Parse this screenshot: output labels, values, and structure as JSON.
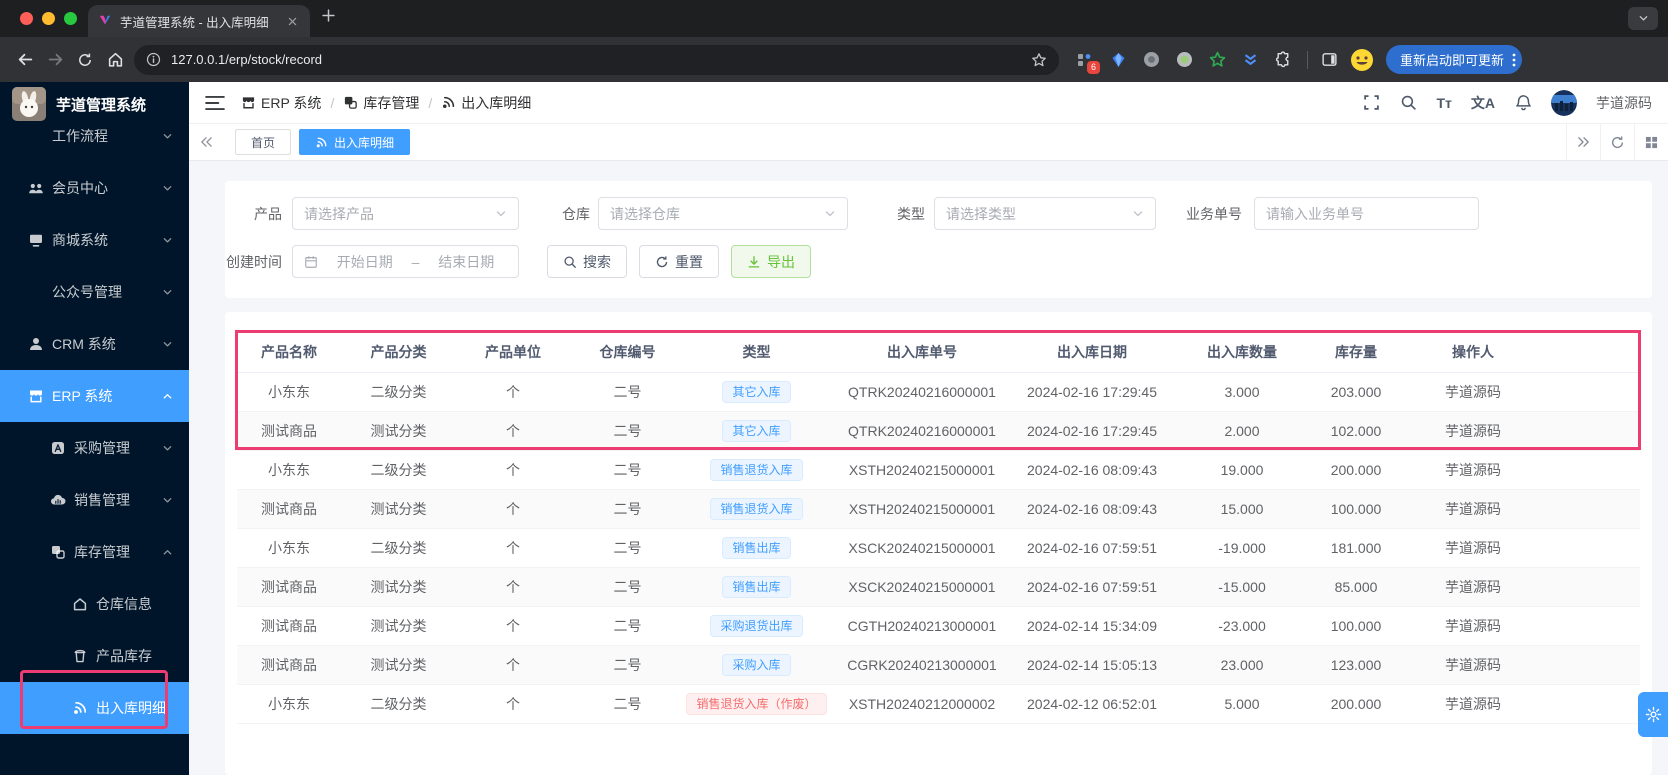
{
  "browser": {
    "tab_title": "芋道管理系统 - 出入库明细",
    "url": "127.0.0.1/erp/stock/record",
    "update_button_label": "重新启动即可更新",
    "extension_badge": "6"
  },
  "sidebar": {
    "logo_title": "芋道管理系统",
    "items": [
      {
        "label": "工作流程"
      },
      {
        "label": "会员中心"
      },
      {
        "label": "商城系统"
      },
      {
        "label": "公众号管理"
      },
      {
        "label": "CRM 系统"
      },
      {
        "label": "ERP 系统",
        "active": true
      },
      {
        "label": "采购管理"
      },
      {
        "label": "销售管理"
      },
      {
        "label": "库存管理"
      },
      {
        "label": "仓库信息"
      },
      {
        "label": "产品库存"
      },
      {
        "label": "出入库明细",
        "active": true
      }
    ]
  },
  "header": {
    "breadcrumb": [
      {
        "label": "ERP 系统"
      },
      {
        "label": "库存管理"
      },
      {
        "label": "出入库明细"
      }
    ],
    "icon_texts": {
      "font_size": "Tт",
      "translate": "文A"
    },
    "username": "芋道源码"
  },
  "tabbar": {
    "tabs": [
      {
        "label": "首页"
      },
      {
        "label": "出入库明细",
        "active": true
      }
    ]
  },
  "filters": {
    "product_label": "产品",
    "product_placeholder": "请选择产品",
    "warehouse_label": "仓库",
    "warehouse_placeholder": "请选择仓库",
    "type_label": "类型",
    "type_placeholder": "请选择类型",
    "bizno_label": "业务单号",
    "bizno_placeholder": "请输入业务单号",
    "created_label": "创建时间",
    "start_placeholder": "开始日期",
    "range_separator": "–",
    "end_placeholder": "结束日期",
    "search_label": "搜索",
    "reset_label": "重置",
    "export_label": "导出"
  },
  "table": {
    "columns": [
      "产品名称",
      "产品分类",
      "产品单位",
      "仓库编号",
      "类型",
      "出入库单号",
      "出入库日期",
      "出入库数量",
      "库存量",
      "操作人"
    ],
    "rows": [
      {
        "product": "小东东",
        "category": "二级分类",
        "unit": "个",
        "warehouse": "二号",
        "type": "其它入库",
        "type_color": "blue",
        "order_no": "QTRK20240216000001",
        "date": "2024-02-16 17:29:45",
        "quantity": "3.000",
        "stock": "203.000",
        "operator": "芋道源码"
      },
      {
        "product": "测试商品",
        "category": "测试分类",
        "unit": "个",
        "warehouse": "二号",
        "type": "其它入库",
        "type_color": "blue",
        "order_no": "QTRK20240216000001",
        "date": "2024-02-16 17:29:45",
        "quantity": "2.000",
        "stock": "102.000",
        "operator": "芋道源码"
      },
      {
        "product": "小东东",
        "category": "二级分类",
        "unit": "个",
        "warehouse": "二号",
        "type": "销售退货入库",
        "type_color": "blue",
        "order_no": "XSTH20240215000001",
        "date": "2024-02-16 08:09:43",
        "quantity": "19.000",
        "stock": "200.000",
        "operator": "芋道源码"
      },
      {
        "product": "测试商品",
        "category": "测试分类",
        "unit": "个",
        "warehouse": "二号",
        "type": "销售退货入库",
        "type_color": "blue",
        "order_no": "XSTH20240215000001",
        "date": "2024-02-16 08:09:43",
        "quantity": "15.000",
        "stock": "100.000",
        "operator": "芋道源码"
      },
      {
        "product": "小东东",
        "category": "二级分类",
        "unit": "个",
        "warehouse": "二号",
        "type": "销售出库",
        "type_color": "blue",
        "order_no": "XSCK20240215000001",
        "date": "2024-02-16 07:59:51",
        "quantity": "-19.000",
        "stock": "181.000",
        "operator": "芋道源码"
      },
      {
        "product": "测试商品",
        "category": "测试分类",
        "unit": "个",
        "warehouse": "二号",
        "type": "销售出库",
        "type_color": "blue",
        "order_no": "XSCK20240215000001",
        "date": "2024-02-16 07:59:51",
        "quantity": "-15.000",
        "stock": "85.000",
        "operator": "芋道源码"
      },
      {
        "product": "测试商品",
        "category": "测试分类",
        "unit": "个",
        "warehouse": "二号",
        "type": "采购退货出库",
        "type_color": "blue",
        "order_no": "CGTH20240213000001",
        "date": "2024-02-14 15:34:09",
        "quantity": "-23.000",
        "stock": "100.000",
        "operator": "芋道源码"
      },
      {
        "product": "测试商品",
        "category": "测试分类",
        "unit": "个",
        "warehouse": "二号",
        "type": "采购入库",
        "type_color": "blue",
        "order_no": "CGRK20240213000001",
        "date": "2024-02-14 15:05:13",
        "quantity": "23.000",
        "stock": "123.000",
        "operator": "芋道源码"
      },
      {
        "product": "小东东",
        "category": "二级分类",
        "unit": "个",
        "warehouse": "二号",
        "type": "销售退货入库（作废）",
        "type_color": "red",
        "order_no": "XSTH20240212000002",
        "date": "2024-02-12 06:52:01",
        "quantity": "5.000",
        "stock": "200.000",
        "operator": "芋道源码"
      }
    ]
  },
  "colors": {
    "accent": "#409eff",
    "sidebar_bg": "#001529",
    "annotation": "#ed3c71",
    "tag_blue": "#409eff",
    "tag_red": "#f56c6c",
    "export_green": "#67c23a"
  }
}
